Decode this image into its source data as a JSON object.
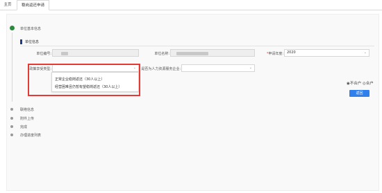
{
  "tabs": [
    {
      "label": "主页",
      "active": false
    },
    {
      "label": "稳岗返还申请",
      "active": true
    }
  ],
  "steps": [
    {
      "label": "单位基本信息",
      "current": true
    },
    {
      "label": "联络信息",
      "current": false
    },
    {
      "label": "附件上传",
      "current": false
    },
    {
      "label": "完成",
      "current": false
    },
    {
      "label": "办理进度列表",
      "current": false
    }
  ],
  "section": {
    "title": "单位信息"
  },
  "form": {
    "unit_code_label": "单位编号:",
    "unit_name_label": "单位名称:",
    "year_label": "申请年度:",
    "year_value": "2020",
    "policy_type_label": "政策享受类型:",
    "policy_type_value": "",
    "hr_service_label": "是否为人力资源服务企业:",
    "hr_service_value": ""
  },
  "dropdown_options": [
    "正常企业稳岗返还（30人以上）",
    "经营困难且仍暂有望稳岗返还（30人以上）"
  ],
  "radio_text": "◉不合户 ◎合户",
  "back_button": "返回",
  "colors": {
    "accent": "#2f80ed",
    "step_done": "#2b8a3e",
    "highlight": "#e53935"
  }
}
